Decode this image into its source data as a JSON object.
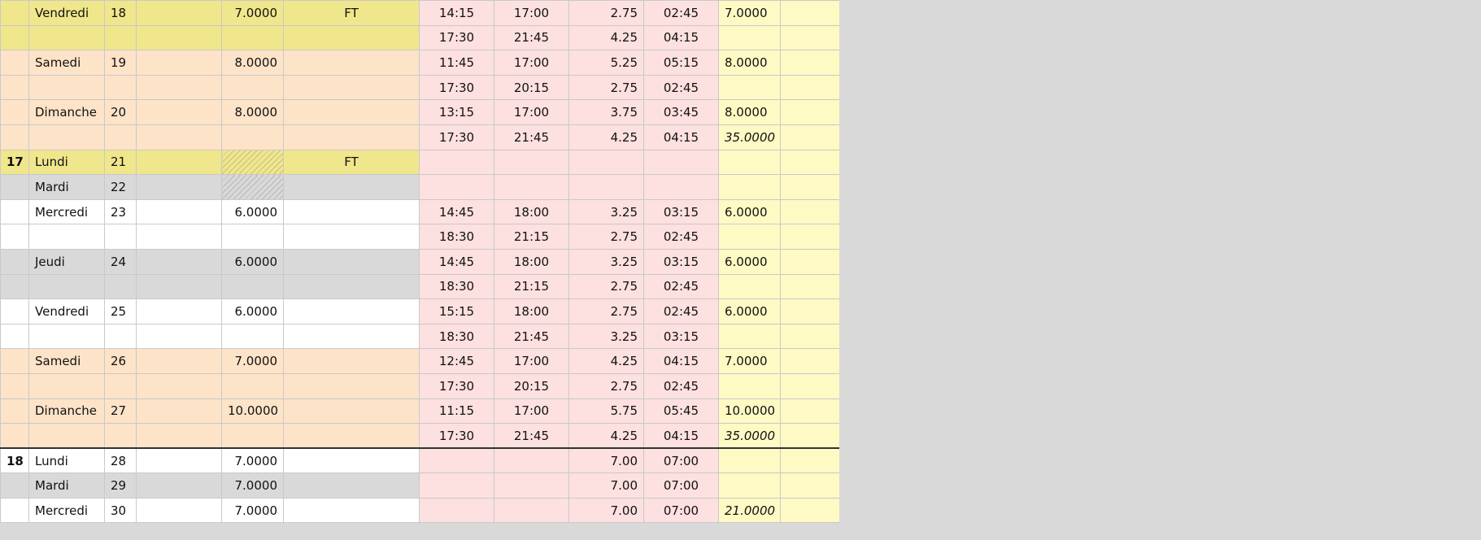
{
  "colors": {
    "friday_ferie": "#f0e68c",
    "weekend": "#fde3c8",
    "weekday": "#ffffff",
    "mardi_grey": "#d9d9d9",
    "time_cols": "#fde0e0",
    "total_cols": "#fff9c4",
    "holiday_monday": "#f0e68c",
    "page_bg": "#d9d9d9"
  },
  "rows": [
    {
      "week": "",
      "day": "Vendredi",
      "date": "18",
      "hours": "7.0000",
      "ft": "FT",
      "start": "14:15",
      "end": "17:00",
      "dec": "2.75",
      "dur": "02:45",
      "total": "7.0000",
      "italic": false,
      "bg": "friday_ferie"
    },
    {
      "week": "",
      "day": "",
      "date": "",
      "hours": "",
      "ft": "",
      "start": "17:30",
      "end": "21:45",
      "dec": "4.25",
      "dur": "04:15",
      "total": "",
      "italic": false,
      "bg": "friday_ferie"
    },
    {
      "week": "",
      "day": "Samedi",
      "date": "19",
      "hours": "8.0000",
      "ft": "",
      "start": "11:45",
      "end": "17:00",
      "dec": "5.25",
      "dur": "05:15",
      "total": "8.0000",
      "italic": false,
      "bg": "weekend"
    },
    {
      "week": "",
      "day": "",
      "date": "",
      "hours": "",
      "ft": "",
      "start": "17:30",
      "end": "20:15",
      "dec": "2.75",
      "dur": "02:45",
      "total": "",
      "italic": false,
      "bg": "weekend"
    },
    {
      "week": "",
      "day": "Dimanche",
      "date": "20",
      "hours": "8.0000",
      "ft": "",
      "start": "13:15",
      "end": "17:00",
      "dec": "3.75",
      "dur": "03:45",
      "total": "8.0000",
      "italic": false,
      "bg": "weekend"
    },
    {
      "week": "",
      "day": "",
      "date": "",
      "hours": "",
      "ft": "",
      "start": "17:30",
      "end": "21:45",
      "dec": "4.25",
      "dur": "04:15",
      "total": "35.0000",
      "italic": true,
      "bg": "weekend"
    },
    {
      "week": "17",
      "day": "Lundi",
      "date": "21",
      "hours": "",
      "ft": "FT",
      "start": "",
      "end": "",
      "dec": "",
      "dur": "",
      "total": "",
      "italic": false,
      "bg": "holiday_monday",
      "hatch": true
    },
    {
      "week": "",
      "day": "Mardi",
      "date": "22",
      "hours": "",
      "ft": "",
      "start": "",
      "end": "",
      "dec": "",
      "dur": "",
      "total": "",
      "italic": false,
      "bg": "mardi_grey",
      "hatch": true
    },
    {
      "week": "",
      "day": "Mercredi",
      "date": "23",
      "hours": "6.0000",
      "ft": "",
      "start": "14:45",
      "end": "18:00",
      "dec": "3.25",
      "dur": "03:15",
      "total": "6.0000",
      "italic": false,
      "bg": "weekday"
    },
    {
      "week": "",
      "day": "",
      "date": "",
      "hours": "",
      "ft": "",
      "start": "18:30",
      "end": "21:15",
      "dec": "2.75",
      "dur": "02:45",
      "total": "",
      "italic": false,
      "bg": "weekday"
    },
    {
      "week": "",
      "day": "Jeudi",
      "date": "24",
      "hours": "6.0000",
      "ft": "",
      "start": "14:45",
      "end": "18:00",
      "dec": "3.25",
      "dur": "03:15",
      "total": "6.0000",
      "italic": false,
      "bg": "mardi_grey"
    },
    {
      "week": "",
      "day": "",
      "date": "",
      "hours": "",
      "ft": "",
      "start": "18:30",
      "end": "21:15",
      "dec": "2.75",
      "dur": "02:45",
      "total": "",
      "italic": false,
      "bg": "mardi_grey"
    },
    {
      "week": "",
      "day": "Vendredi",
      "date": "25",
      "hours": "6.0000",
      "ft": "",
      "start": "15:15",
      "end": "18:00",
      "dec": "2.75",
      "dur": "02:45",
      "total": "6.0000",
      "italic": false,
      "bg": "weekday"
    },
    {
      "week": "",
      "day": "",
      "date": "",
      "hours": "",
      "ft": "",
      "start": "18:30",
      "end": "21:45",
      "dec": "3.25",
      "dur": "03:15",
      "total": "",
      "italic": false,
      "bg": "weekday"
    },
    {
      "week": "",
      "day": "Samedi",
      "date": "26",
      "hours": "7.0000",
      "ft": "",
      "start": "12:45",
      "end": "17:00",
      "dec": "4.25",
      "dur": "04:15",
      "total": "7.0000",
      "italic": false,
      "bg": "weekend"
    },
    {
      "week": "",
      "day": "",
      "date": "",
      "hours": "",
      "ft": "",
      "start": "17:30",
      "end": "20:15",
      "dec": "2.75",
      "dur": "02:45",
      "total": "",
      "italic": false,
      "bg": "weekend"
    },
    {
      "week": "",
      "day": "Dimanche",
      "date": "27",
      "hours": "10.0000",
      "ft": "",
      "start": "11:15",
      "end": "17:00",
      "dec": "5.75",
      "dur": "05:45",
      "total": "10.0000",
      "italic": false,
      "bg": "weekend"
    },
    {
      "week": "",
      "day": "",
      "date": "",
      "hours": "",
      "ft": "",
      "start": "17:30",
      "end": "21:45",
      "dec": "4.25",
      "dur": "04:15",
      "total": "35.0000",
      "italic": true,
      "bg": "weekend",
      "weekEnd": true
    },
    {
      "week": "18",
      "day": "Lundi",
      "date": "28",
      "hours": "7.0000",
      "ft": "",
      "start": "",
      "end": "",
      "dec": "7.00",
      "dur": "07:00",
      "total": "",
      "italic": false,
      "bg": "weekday"
    },
    {
      "week": "",
      "day": "Mardi",
      "date": "29",
      "hours": "7.0000",
      "ft": "",
      "start": "",
      "end": "",
      "dec": "7.00",
      "dur": "07:00",
      "total": "",
      "italic": false,
      "bg": "mardi_grey"
    },
    {
      "week": "",
      "day": "Mercredi",
      "date": "30",
      "hours": "7.0000",
      "ft": "",
      "start": "",
      "end": "",
      "dec": "7.00",
      "dur": "07:00",
      "total": "21.0000",
      "italic": true,
      "bg": "weekday"
    }
  ]
}
